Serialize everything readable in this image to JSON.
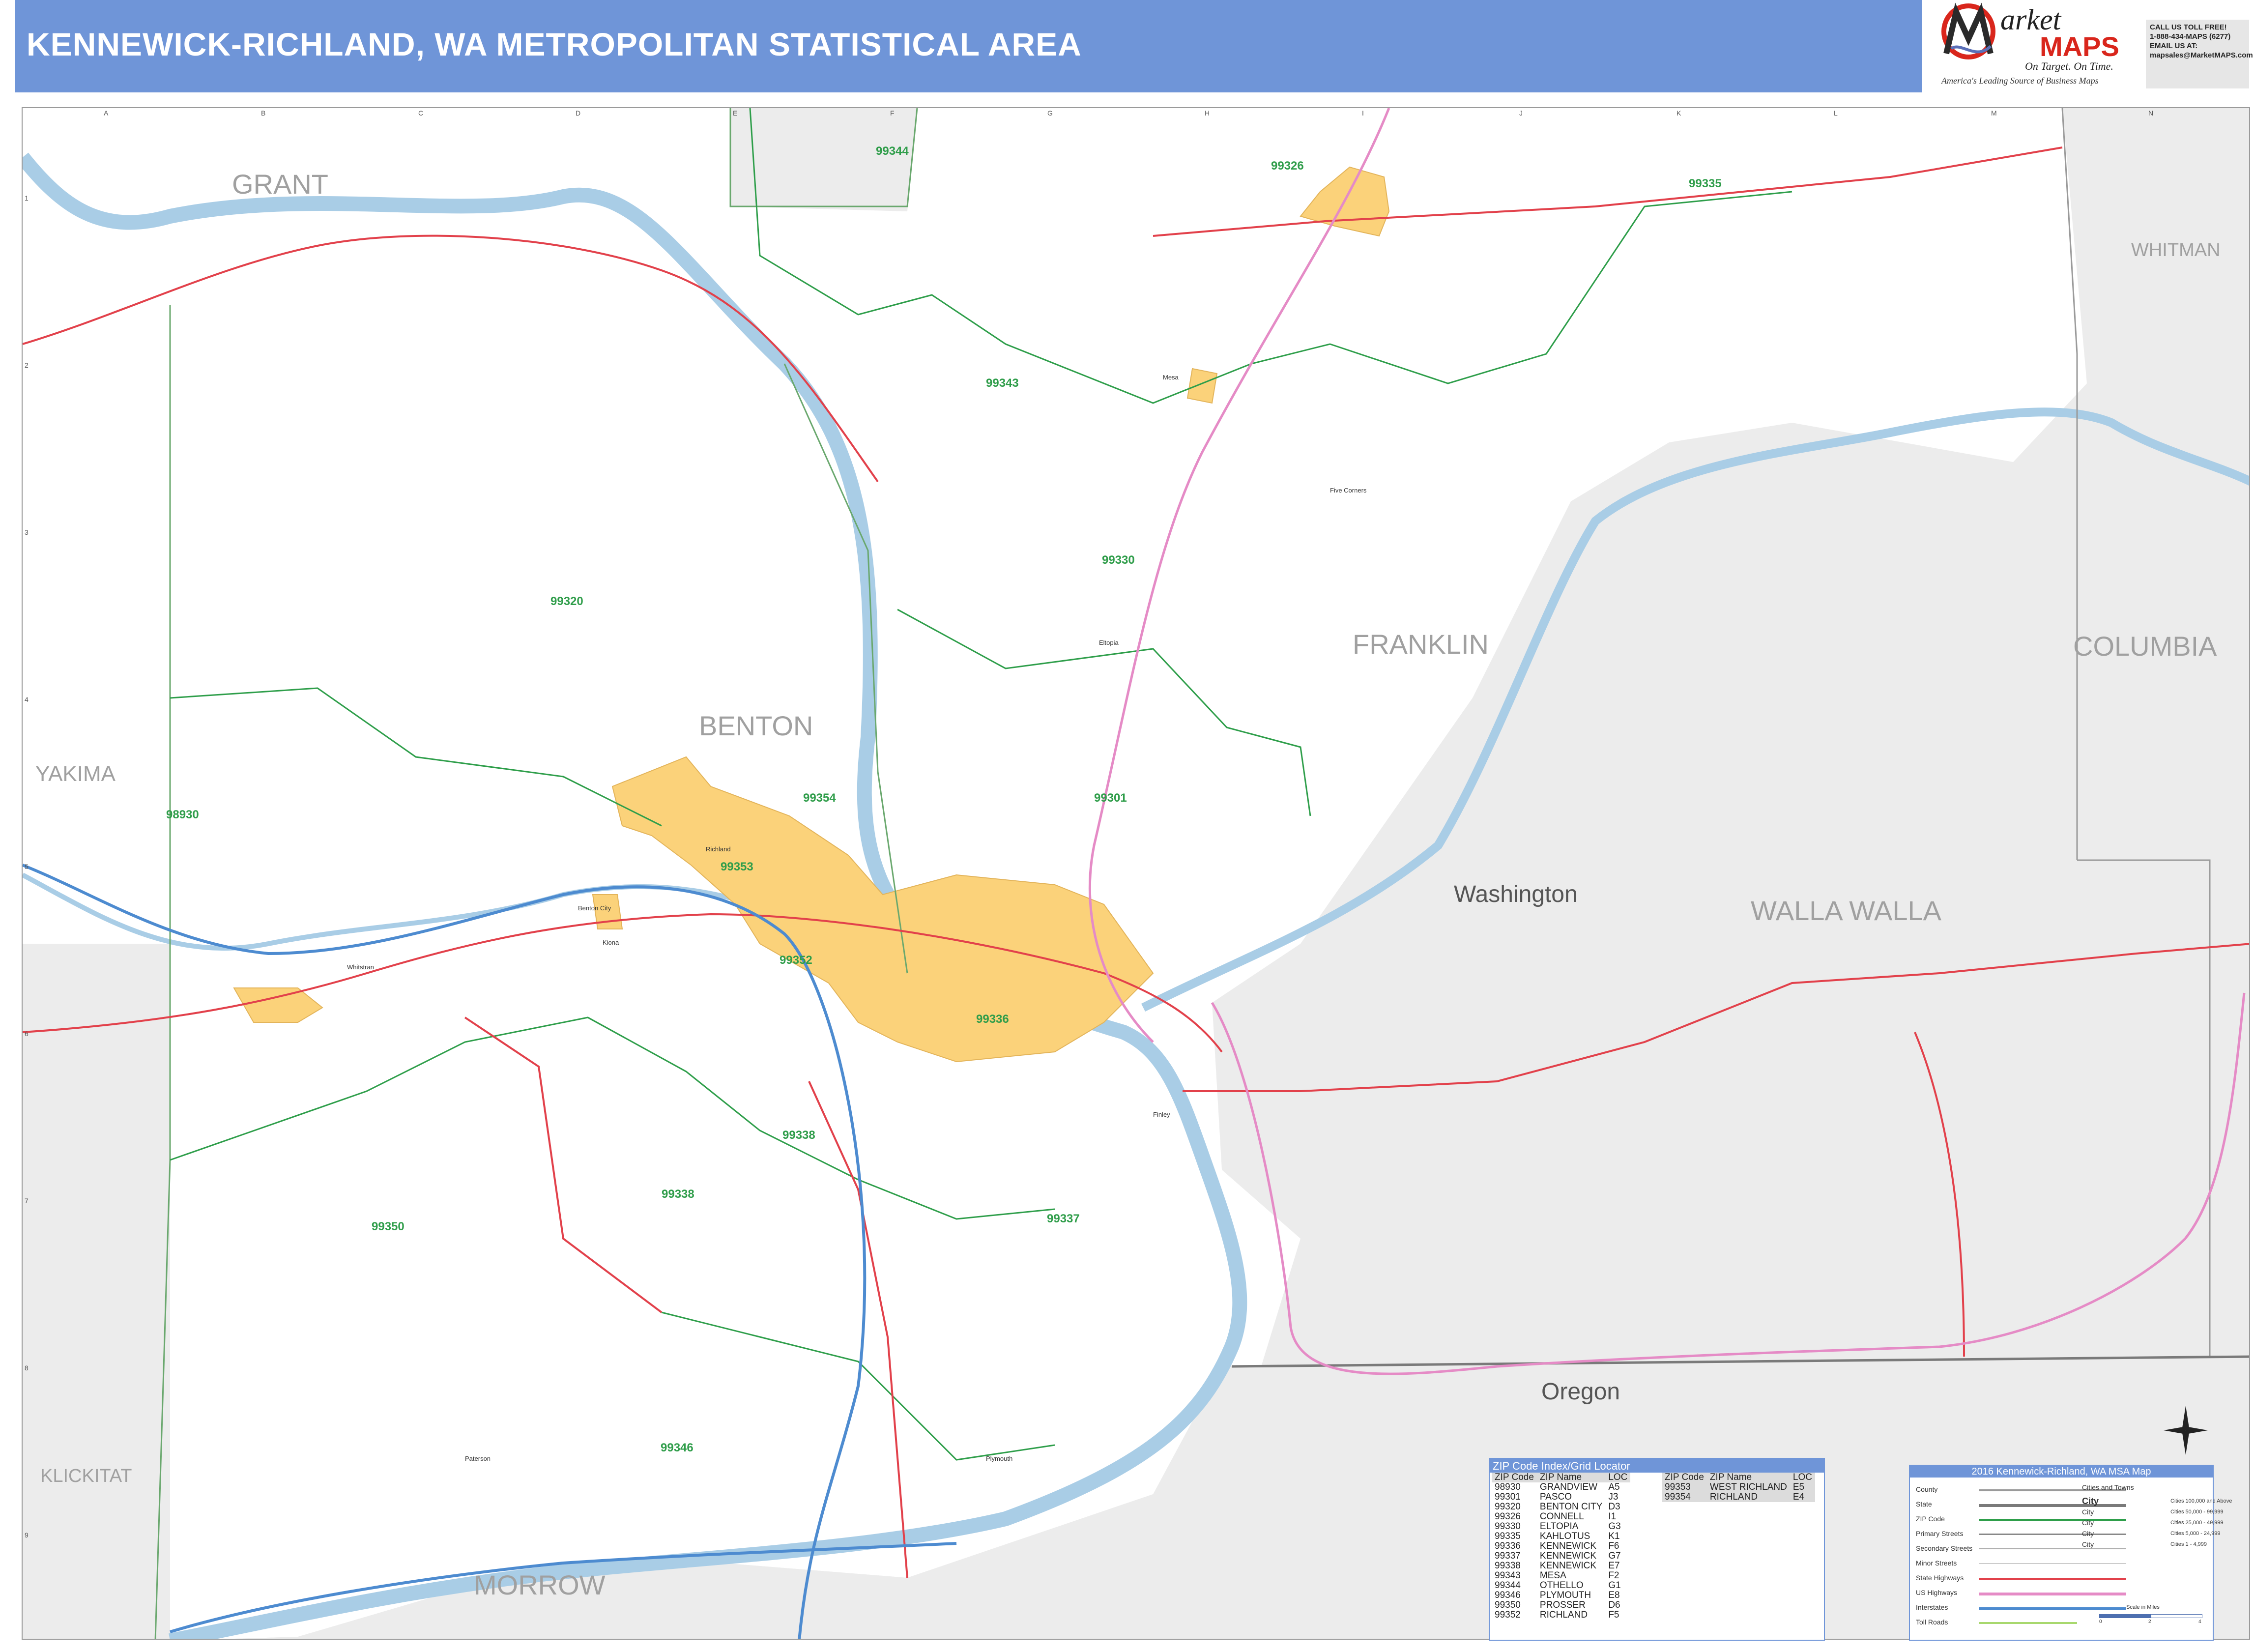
{
  "header": {
    "title": "KENNEWICK-RICHLAND, WA METROPOLITAN STATISTICAL AREA"
  },
  "logo": {
    "brand": "arket",
    "maps": "MAPS",
    "tagline": "On Target. On Time.",
    "sub": "America's Leading Source of Business Maps"
  },
  "contact": {
    "line1": "CALL US TOLL FREE!",
    "line2": "1-888-434-MAPS (6277)",
    "line3": "EMAIL US AT:",
    "line4": "mapsales@MarketMAPS.com"
  },
  "grid": {
    "letters": [
      "A",
      "B",
      "C",
      "D",
      "E",
      "F",
      "G",
      "H",
      "I",
      "J",
      "K",
      "L",
      "M",
      "N"
    ],
    "numbers": [
      "1",
      "2",
      "3",
      "4",
      "5",
      "6",
      "7",
      "8",
      "9"
    ]
  },
  "counties": {
    "grant": "GRANT",
    "whitman": "WHITMAN",
    "yakima": "YAKIMA",
    "benton": "BENTON",
    "franklin": "FRANKLIN",
    "columbia": "COLUMBIA",
    "walla_walla": "WALLA WALLA",
    "klickitat": "KLICKITAT",
    "morrow": "MORROW"
  },
  "states": {
    "washington": "Washington",
    "oregon": "Oregon"
  },
  "zip_labels": {
    "z99344": "99344",
    "z99326": "99326",
    "z99335": "99335",
    "z99343": "99343",
    "z99330": "99330",
    "z99320": "99320",
    "z99354": "99354",
    "z98930": "98930",
    "z99353": "99353",
    "z99301": "99301",
    "z99352": "99352",
    "z99336": "99336",
    "z99338a": "99338",
    "z99338b": "99338",
    "z99337": "99337",
    "z99350": "99350",
    "z99346": "99346"
  },
  "towns": {
    "benton_city": "Benton City",
    "mesa": "Mesa",
    "eltopia": "Eltopia",
    "five_corners": "Five Corners",
    "richland": "Richland",
    "finley": "Finley",
    "plymouth": "Plymouth",
    "paterson": "Paterson",
    "whitstran": "Whitstran",
    "kiona": "Kiona"
  },
  "zip_index": {
    "title": "ZIP Code Index/Grid Locator",
    "headers": [
      "ZIP Code",
      "ZIP Name",
      "LOC"
    ],
    "left": [
      [
        "98930",
        "GRANDVIEW",
        "A5"
      ],
      [
        "99301",
        "PASCO",
        "J3"
      ],
      [
        "99320",
        "BENTON CITY",
        "D3"
      ],
      [
        "99326",
        "CONNELL",
        "I1"
      ],
      [
        "99330",
        "ELTOPIA",
        "G3"
      ],
      [
        "99335",
        "KAHLOTUS",
        "K1"
      ],
      [
        "99336",
        "KENNEWICK",
        "F6"
      ],
      [
        "99337",
        "KENNEWICK",
        "G7"
      ],
      [
        "99338",
        "KENNEWICK",
        "E7"
      ],
      [
        "99343",
        "MESA",
        "F2"
      ],
      [
        "99344",
        "OTHELLO",
        "G1"
      ],
      [
        "99346",
        "PLYMOUTH",
        "E8"
      ],
      [
        "99350",
        "PROSSER",
        "D6"
      ],
      [
        "99352",
        "RICHLAND",
        "F5"
      ]
    ],
    "right": [
      [
        "99353",
        "WEST RICHLAND",
        "E5"
      ],
      [
        "99354",
        "RICHLAND",
        "E4"
      ]
    ]
  },
  "legend": {
    "title": "2016 Kennewick-Richland, WA MSA Map",
    "items": [
      "County",
      "State",
      "ZIP Code",
      "Primary Streets",
      "Secondary Streets",
      "Minor Streets",
      "State Highways",
      "US Highways",
      "Interstates",
      "Toll Roads"
    ],
    "cities_title": "Cities and Towns",
    "cities": [
      "City",
      "City",
      "City",
      "City",
      "City"
    ],
    "cities_ranges": [
      "Cities 100,000 and Above",
      "Cities 50,000 - 99,999",
      "Cities 25,000 - 49,999",
      "Cities 5,000 - 24,999",
      "Cities 1 - 4,999"
    ],
    "scale_title": "Scale in Miles",
    "scale_ticks": [
      "0",
      "2",
      "4"
    ]
  },
  "colors": {
    "header": "#6f95d8",
    "water": "#a9cde6",
    "urban": "#fbd27a",
    "county_border": "#6aa86e",
    "zip_border": "#2e9e4a",
    "highway": "#e2414b",
    "us_highway": "#e58bc6",
    "land": "#ffffff",
    "outside": "#ececec"
  }
}
